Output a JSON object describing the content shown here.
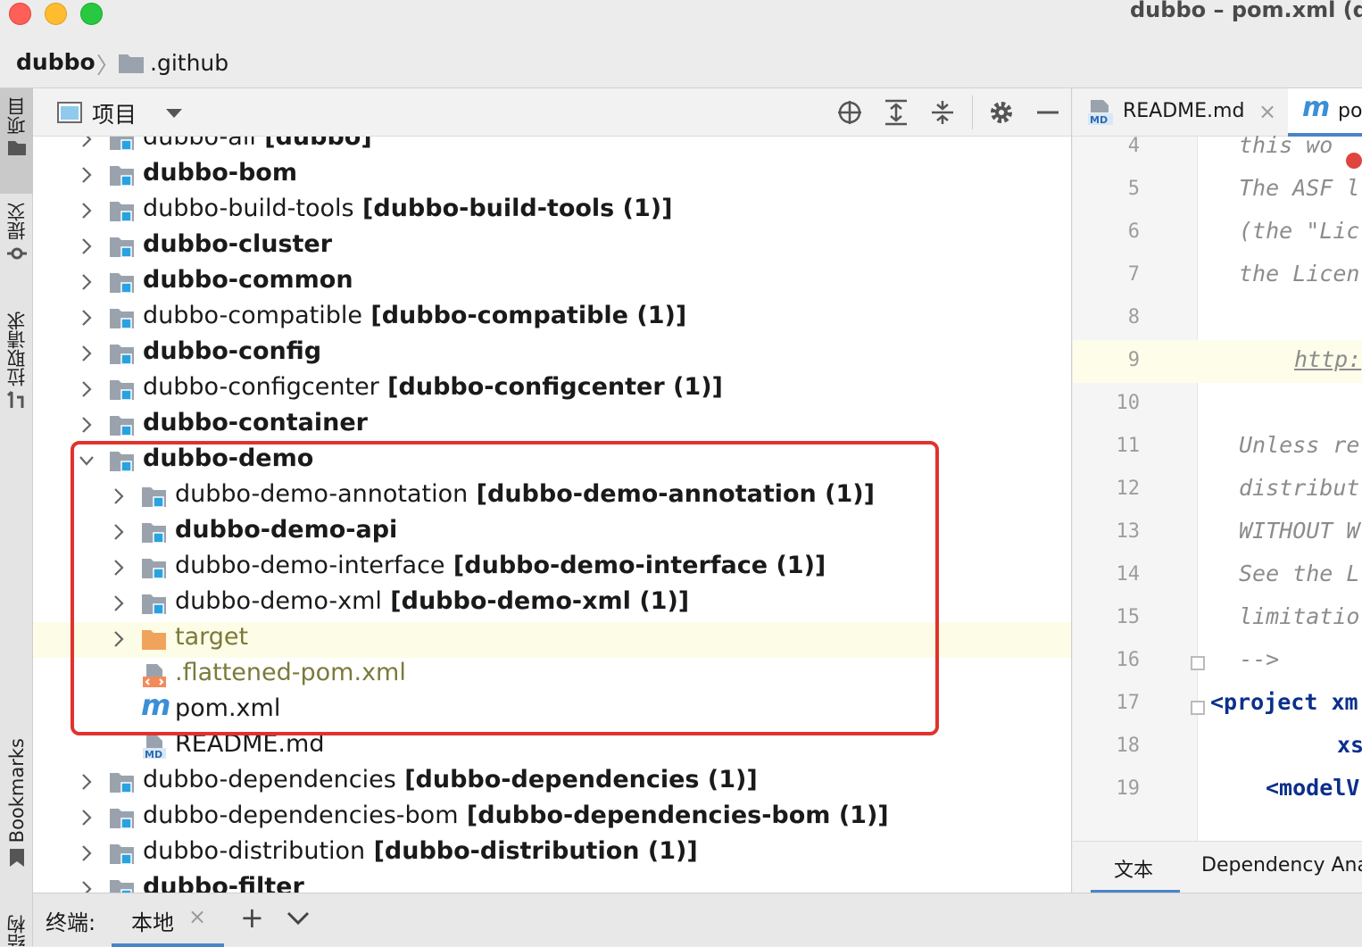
{
  "window": {
    "title": "dubbo – pom.xml (d"
  },
  "breadcrumb": {
    "root": "dubbo",
    "child": ".github"
  },
  "left_strip": {
    "tabs": [
      {
        "label": "项目"
      },
      {
        "label": "提交"
      },
      {
        "label": "拉取请求"
      },
      {
        "label": "Bookmarks"
      },
      {
        "label": "结构"
      }
    ]
  },
  "project_panel": {
    "title": "项目",
    "tree": [
      {
        "name": "dubbo-all",
        "suffix": " [dubbo]",
        "bold_name": false,
        "expanded": false
      },
      {
        "name": "dubbo-bom",
        "suffix": "",
        "bold_name": true,
        "expanded": false
      },
      {
        "name": "dubbo-build-tools",
        "suffix": " [dubbo-build-tools (1)]",
        "bold_name": false,
        "expanded": false
      },
      {
        "name": "dubbo-cluster",
        "suffix": "",
        "bold_name": true,
        "expanded": false
      },
      {
        "name": "dubbo-common",
        "suffix": "",
        "bold_name": true,
        "expanded": false
      },
      {
        "name": "dubbo-compatible",
        "suffix": " [dubbo-compatible (1)]",
        "bold_name": false,
        "expanded": false
      },
      {
        "name": "dubbo-config",
        "suffix": "",
        "bold_name": true,
        "expanded": false
      },
      {
        "name": "dubbo-configcenter",
        "suffix": " [dubbo-configcenter (1)]",
        "bold_name": false,
        "expanded": false
      },
      {
        "name": "dubbo-container",
        "suffix": "",
        "bold_name": true,
        "expanded": false
      },
      {
        "name": "dubbo-demo",
        "suffix": "",
        "bold_name": true,
        "expanded": true
      },
      {
        "name": "dubbo-demo-annotation",
        "suffix": " [dubbo-demo-annotation (1)]",
        "bold_name": false,
        "expanded": false
      },
      {
        "name": "dubbo-demo-api",
        "suffix": "",
        "bold_name": true,
        "expanded": false
      },
      {
        "name": "dubbo-demo-interface",
        "suffix": " [dubbo-demo-interface (1)]",
        "bold_name": false,
        "expanded": false
      },
      {
        "name": "dubbo-demo-xml",
        "suffix": " [dubbo-demo-xml (1)]",
        "bold_name": false,
        "expanded": false
      },
      {
        "name": "target",
        "suffix": "",
        "bold_name": false,
        "expanded": false
      },
      {
        "name": ".flattened-pom.xml",
        "suffix": "",
        "bold_name": false,
        "expanded": false
      },
      {
        "name": "pom.xml",
        "suffix": "",
        "bold_name": false,
        "expanded": false
      },
      {
        "name": "README.md",
        "suffix": "",
        "bold_name": false,
        "expanded": false
      },
      {
        "name": "dubbo-dependencies",
        "suffix": " [dubbo-dependencies (1)]",
        "bold_name": false,
        "expanded": false
      },
      {
        "name": "dubbo-dependencies-bom",
        "suffix": " [dubbo-dependencies-bom (1)]",
        "bold_name": false,
        "expanded": false
      },
      {
        "name": "dubbo-distribution",
        "suffix": " [dubbo-distribution (1)]",
        "bold_name": false,
        "expanded": false
      },
      {
        "name": "dubbo-filter",
        "suffix": "",
        "bold_name": true,
        "expanded": false
      }
    ]
  },
  "editor": {
    "tabs": [
      {
        "label": "README.md",
        "close": "×"
      },
      {
        "label": "po"
      }
    ],
    "lines": [
      {
        "n": "4",
        "text": "this wo"
      },
      {
        "n": "5",
        "text": "The ASF l"
      },
      {
        "n": "6",
        "text": "(the \"Lic"
      },
      {
        "n": "7",
        "text": "the Licen"
      },
      {
        "n": "8",
        "text": ""
      },
      {
        "n": "9",
        "text": "http:"
      },
      {
        "n": "10",
        "text": ""
      },
      {
        "n": "11",
        "text": "Unless re"
      },
      {
        "n": "12",
        "text": "distribut"
      },
      {
        "n": "13",
        "text": "WITHOUT W"
      },
      {
        "n": "14",
        "text": "See the L"
      },
      {
        "n": "15",
        "text": "limitatio"
      },
      {
        "n": "16",
        "text": "-->"
      },
      {
        "n": "17",
        "text": "<project xm"
      },
      {
        "n": "18",
        "text": "xs"
      },
      {
        "n": "19",
        "text": "<modelV"
      }
    ],
    "bottom_tabs": [
      {
        "label": "文本"
      },
      {
        "label": "Dependency Ana"
      }
    ]
  },
  "terminal": {
    "label": "终端:",
    "tab": "本地",
    "close": "×",
    "add": "+"
  },
  "colors": {
    "highlight_box": "#e0332d",
    "row_highlight": "#fdfde7",
    "folder_blue": "#29a2e2",
    "folder_orange": "#f0a35a",
    "maven_blue": "#3a8fd6"
  }
}
